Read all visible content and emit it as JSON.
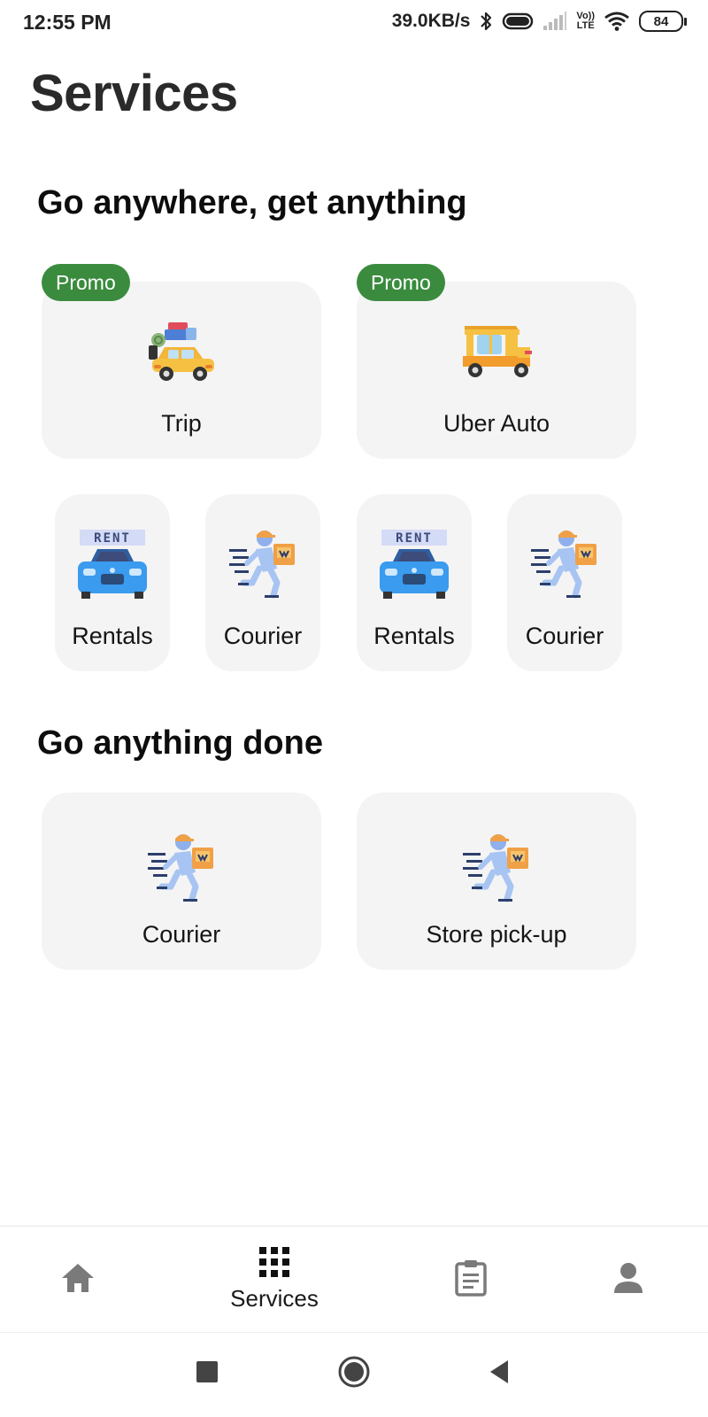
{
  "status_bar": {
    "time": "12:55 PM",
    "network_speed": "39.0KB/s",
    "network_type_top": "Vo))",
    "network_type_bottom": "LTE",
    "battery_level": "84",
    "icons": [
      "bluetooth-icon",
      "toggle-icon",
      "signal-icon",
      "volte-icon",
      "wifi-icon",
      "battery-icon"
    ]
  },
  "page": {
    "title": "Services"
  },
  "sections": [
    {
      "title": "Go anywhere, get anything",
      "big_cards": [
        {
          "label": "Trip",
          "promo": "Promo",
          "icon": "car-with-luggage-icon"
        },
        {
          "label": "Uber Auto",
          "promo": "Promo",
          "icon": "auto-rickshaw-icon"
        }
      ],
      "small_cards": [
        {
          "label": "Rentals",
          "icon": "rental-car-icon",
          "sign": "RENT"
        },
        {
          "label": "Courier",
          "icon": "courier-icon"
        },
        {
          "label": "Rentals",
          "icon": "rental-car-icon",
          "sign": "RENT"
        },
        {
          "label": "Courier",
          "icon": "courier-icon"
        }
      ]
    },
    {
      "title": "Go anything done",
      "big_cards": [
        {
          "label": "Courier",
          "icon": "courier-icon"
        },
        {
          "label": "Store pick-up",
          "icon": "courier-icon"
        }
      ]
    }
  ],
  "bottom_nav": {
    "items": [
      {
        "icon": "home-icon",
        "label": ""
      },
      {
        "icon": "grid-icon",
        "label": "Services",
        "active": true
      },
      {
        "icon": "clipboard-icon",
        "label": ""
      },
      {
        "icon": "person-icon",
        "label": ""
      }
    ]
  },
  "colors": {
    "promo_bg": "#3a8b3e",
    "card_bg": "#f4f4f4",
    "nav_inactive": "#7a7a7a",
    "text_dark": "#111111"
  }
}
